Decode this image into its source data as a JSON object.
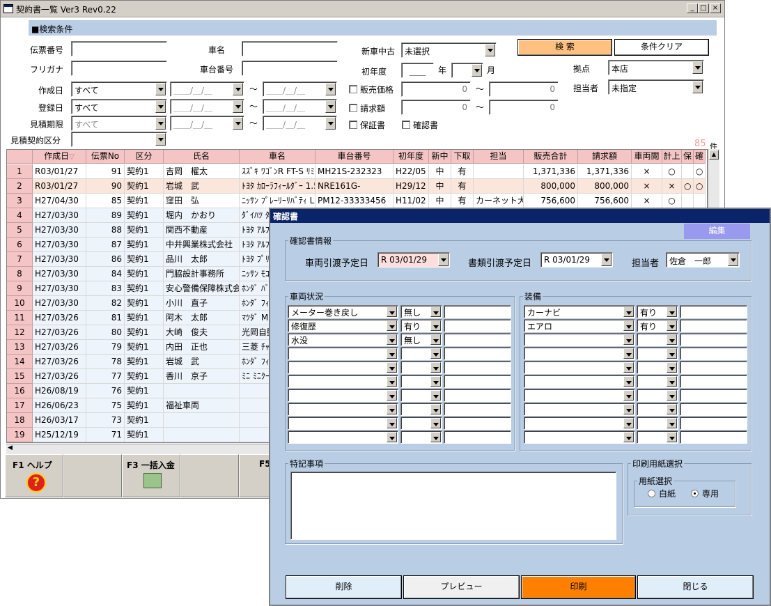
{
  "window": {
    "title": "契約書一覧 Ver3 Rev0.22",
    "min": "_",
    "max": "□",
    "close": "×"
  },
  "search": {
    "header": "■検索条件",
    "denpyo_no_label": "伝票番号",
    "denpyo_no": "",
    "furigana_label": "フリガナ",
    "furigana": "",
    "sakusei_label": "作成日",
    "sakusei_value": "すべて",
    "touroku_label": "登録日",
    "touroku_value": "すべて",
    "mitsumori_kigen_label": "見積期限",
    "mitsumori_kigen_value": "すべて",
    "mitsumori_kubun_label": "見積契約区分",
    "mitsumori_kubun_value": "",
    "date_placeholder": "＿＿/＿/＿",
    "tilde": "～",
    "shamei_label": "車名",
    "shamei": "",
    "shadai_label": "車台番号",
    "shadai": "",
    "shinsha_label": "新車中古",
    "shinsha_value": "未選択",
    "shonendo_label": "初年度",
    "shonendo_value": "＿＿",
    "nen": "年",
    "getsu": "月",
    "hanbai_label": "販売価格",
    "hanbai_from": "0",
    "hanbai_to": "0",
    "seikyu_label": "請求額",
    "seikyu_from": "0",
    "seikyu_to": "0",
    "hoshousho_label": "保証書",
    "kakuninsho_label": "確認書",
    "search_btn": "検 索",
    "clear_btn": "条件クリア",
    "kyoten_label": "拠点",
    "kyoten_value": "本店",
    "tantou_label": "担当者",
    "tantou_value": "未指定",
    "count": "85",
    "count_unit": "件"
  },
  "grid": {
    "headers": [
      "作成日",
      "伝票No",
      "区分",
      "氏名",
      "車名",
      "車台番号",
      "初年度",
      "新中",
      "下取",
      "担当",
      "販売合計",
      "請求額",
      "車両閲",
      "計上",
      "保",
      "確"
    ],
    "sort_arrow": "▽",
    "rows": [
      {
        "no": "1",
        "date": "R03/01/27",
        "den": "91",
        "kubun": "契約1",
        "name": "吉岡　櫂太",
        "car": "ｽｽﾞｷ ﾜｺﾞﾝR FT-S ﾘﾐ",
        "vin": "MH21S-232323",
        "year": "H22/05",
        "new": "中",
        "shita": "有",
        "tan": "",
        "total": "1,371,336",
        "seik": "1,371,336",
        "ken": "×",
        "kei": "○",
        "ho": "",
        "ka": "○"
      },
      {
        "no": "2",
        "date": "R03/01/27",
        "den": "90",
        "kubun": "契約1",
        "name": "岩城　武",
        "car": "ﾄﾖﾀ ｶﾛｰﾗﾌｨｰﾙﾀﾞｰ 1.5",
        "vin": "NRE161G-",
        "year": "H29/12",
        "new": "中",
        "shita": "有",
        "tan": "",
        "total": "800,000",
        "seik": "800,000",
        "ken": "×",
        "kei": "×",
        "ho": "○",
        "ka": "○"
      },
      {
        "no": "3",
        "date": "H27/04/30",
        "den": "85",
        "kubun": "契約1",
        "name": "窪田　弘",
        "car": "ﾆｯｻﾝ ﾌﾟﾚｰﾘｰﾘﾊﾞﾃｨ L",
        "vin": "PM12-33333456",
        "year": "H11/02",
        "new": "中",
        "shita": "有",
        "tan": "カーネット大",
        "total": "756,600",
        "seik": "756,600",
        "ken": "×",
        "kei": "○",
        "ho": "",
        "ka": ""
      },
      {
        "no": "4",
        "date": "H27/03/30",
        "den": "89",
        "kubun": "契約1",
        "name": "堀内　かおり",
        "car": "ﾀﾞｲﾊﾂ ﾀ"
      },
      {
        "no": "5",
        "date": "H27/03/30",
        "den": "88",
        "kubun": "契約1",
        "name": "関西不動産",
        "car": "ﾄﾖﾀ ｱﾙﾌ"
      },
      {
        "no": "6",
        "date": "H27/03/30",
        "den": "87",
        "kubun": "契約1",
        "name": "中井興業株式会社",
        "car": "ﾄﾖﾀ ｱﾙﾌ"
      },
      {
        "no": "7",
        "date": "H27/03/30",
        "den": "86",
        "kubun": "契約1",
        "name": "品川　太郎",
        "car": "ﾄﾖﾀ ﾌﾟﾘ"
      },
      {
        "no": "8",
        "date": "H27/03/30",
        "den": "84",
        "kubun": "契約1",
        "name": "門脇設計事務所",
        "car": "ﾆｯｻﾝ ﾓｺ"
      },
      {
        "no": "9",
        "date": "H27/03/30",
        "den": "83",
        "kubun": "契約1",
        "name": "安心警備保障株式会社",
        "car": "ﾎﾝﾀﾞ ﾊﾞ"
      },
      {
        "no": "10",
        "date": "H27/03/30",
        "den": "82",
        "kubun": "契約1",
        "name": "小川　直子",
        "car": "ﾎﾝﾀﾞ ﾌｨ"
      },
      {
        "no": "11",
        "date": "H27/03/26",
        "den": "81",
        "kubun": "契約1",
        "name": "阿木　太郎",
        "car": "ﾏﾂﾀﾞ M"
      },
      {
        "no": "12",
        "date": "H27/03/26",
        "den": "80",
        "kubun": "契約1",
        "name": "大崎　俊夫",
        "car": "光岡自動"
      },
      {
        "no": "13",
        "date": "H27/03/26",
        "den": "79",
        "kubun": "契約1",
        "name": "内田　正也",
        "car": "三菱 ﾁｬ"
      },
      {
        "no": "14",
        "date": "H27/03/26",
        "den": "78",
        "kubun": "契約1",
        "name": "岩城　武",
        "car": "ﾎﾝﾀﾞ ﾌｨ"
      },
      {
        "no": "15",
        "date": "H27/03/26",
        "den": "77",
        "kubun": "契約1",
        "name": "香川　京子",
        "car": "ﾐﾆ ﾐﾆｸｰ"
      },
      {
        "no": "16",
        "date": "H26/08/19",
        "den": "76",
        "kubun": "契約1",
        "name": "",
        "car": ""
      },
      {
        "no": "17",
        "date": "H26/06/23",
        "den": "75",
        "kubun": "契約1",
        "name": "福祉車両",
        "car": ""
      },
      {
        "no": "18",
        "date": "H26/03/17",
        "den": "73",
        "kubun": "契約1",
        "name": "",
        "car": ""
      },
      {
        "no": "19",
        "date": "H25/12/19",
        "den": "71",
        "kubun": "契約1",
        "name": "",
        "car": ""
      }
    ]
  },
  "fkeys": {
    "f1": "F1 ヘルプ",
    "f3": "F3 一括入金",
    "f5": "F5"
  },
  "dialog": {
    "title": "確認書",
    "edit_btn": "編集",
    "info_group": "確認書情報",
    "sharyo_label": "車両引渡予定日",
    "sharyo_value": "R 03/01/29",
    "shorui_label": "書類引渡予定日",
    "shorui_value": "R 03/01/29",
    "tantou_label": "担当者",
    "tantou_value": "佐倉　一郎",
    "jokyo_group": "車両状況",
    "jokyo": [
      {
        "item": "メーター巻き戻し",
        "val": "無し"
      },
      {
        "item": "修復歴",
        "val": "有り"
      },
      {
        "item": "水没",
        "val": "無し"
      }
    ],
    "soubi_group": "装備",
    "soubi": [
      {
        "item": "カーナビ",
        "val": "有り"
      },
      {
        "item": "エアロ",
        "val": "有り"
      }
    ],
    "tokki_group": "特記事項",
    "insatsu_group": "印刷用紙選択",
    "youshi_group": "用紙選択",
    "hakushi": "白紙",
    "senyou": "専用",
    "delete_btn": "削除",
    "preview_btn": "プレビュー",
    "print_btn": "印刷",
    "close_btn": "閉じる"
  },
  "colors": {
    "accent_orange": "#ff7f00",
    "header_blue": "#b9cde5",
    "title_navy": "#0a246a",
    "grid_header_pink": "#f5c5c5",
    "search_btn": "#ffc080",
    "edit_btn": "#9999ee"
  }
}
